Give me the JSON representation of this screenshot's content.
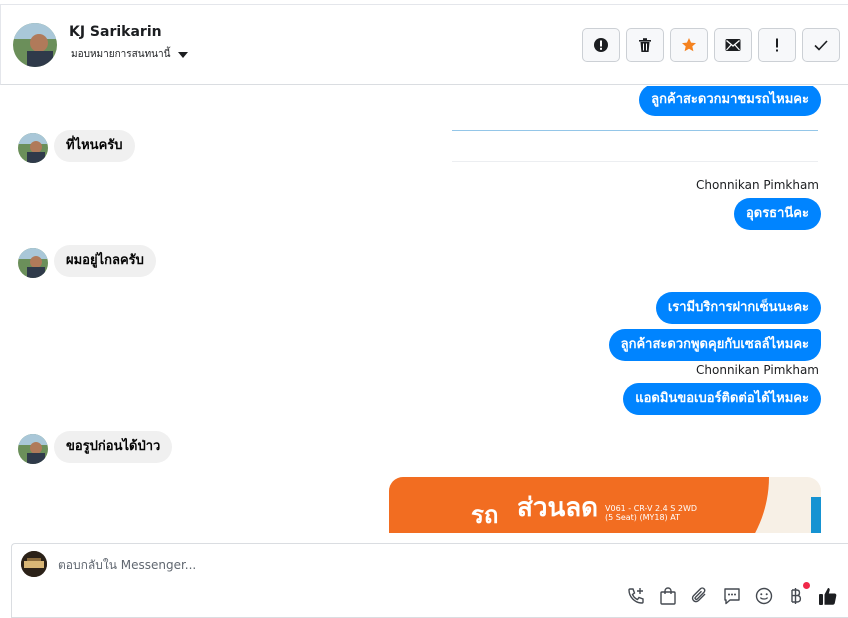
{
  "header": {
    "contact_name": "KJ Sarikarin",
    "assign_label": "มอบหมายการสนทนานี้",
    "actions": [
      "alert-icon",
      "trash-icon",
      "star-icon",
      "envelope-icon",
      "exclamation-icon",
      "check-icon"
    ],
    "star_color": "#f5821f"
  },
  "thread": {
    "msg_out_1": "ลูกค้าสะดวกมาชมรถไหมคะ",
    "msg_in_1": "ที่ไหนครับ",
    "sender_1": "Chonnikan Pimkham",
    "msg_out_2": "อุดรธานีคะ",
    "msg_in_2": "ผมอยู่ไกลครับ",
    "msg_out_3": "เรามีบริการฝากเซ็นนะคะ",
    "msg_out_4": "ลูกค้าสะดวกพูดคุยกับเซลล์ไหมคะ",
    "sender_2": "Chonnikan Pimkham",
    "msg_out_5": "แอดมินขอเบอร์ติดต่อได้ไหมคะ",
    "msg_in_3": "ขอรูปก่อนได้ป่าว",
    "promo": {
      "text_a": "รถ",
      "text_b": "ส่วนลด",
      "detail_1": "V061 - CR-V 2.4 S 2WD",
      "detail_2": "(5 Seat) (MY18) AT"
    },
    "bubble_color": "#0084ff"
  },
  "composer": {
    "placeholder": "ตอบกลับใน Messenger...",
    "tools": [
      "call-add-icon",
      "shopping-bag-icon",
      "paperclip-icon",
      "saved-reply-icon",
      "emoji-icon",
      "baht-icon",
      "like-icon"
    ]
  }
}
